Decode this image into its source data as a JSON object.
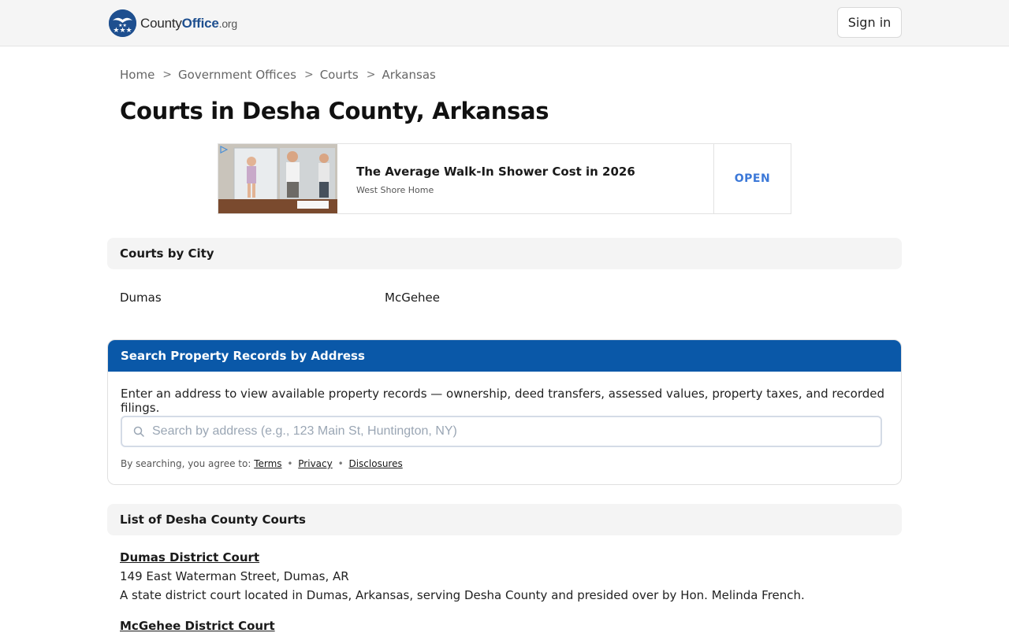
{
  "header": {
    "logo": {
      "part1": "County",
      "part2": "Office",
      "part3": ".org"
    },
    "signin_label": "Sign in"
  },
  "breadcrumb": [
    "Home",
    "Government Offices",
    "Courts",
    "Arkansas"
  ],
  "page_title": "Courts in Desha County, Arkansas",
  "ad": {
    "headline": "The Average Walk-In Shower Cost in 2026",
    "sponsor": "West Shore Home",
    "cta": "OPEN"
  },
  "courts_by_city": {
    "heading": "Courts by City",
    "cities": [
      "Dumas",
      "McGehee"
    ]
  },
  "search": {
    "heading": "Search Property Records by Address",
    "description": "Enter an address to view available property records — ownership, deed transfers, assessed values, property taxes, and recorded filings.",
    "placeholder": "Search by address (e.g., 123 Main St, Huntington, NY)",
    "agree_prefix": "By searching, you agree to:",
    "links": [
      "Terms",
      "Privacy",
      "Disclosures"
    ]
  },
  "court_list": {
    "heading": "List of Desha County Courts",
    "courts": [
      {
        "name": "Dumas District Court",
        "address": "149 East Waterman Street, Dumas, AR",
        "description": "A state district court located in Dumas, Arkansas, serving Desha County and presided over by Hon. Melinda French."
      },
      {
        "name": "McGehee District Court"
      }
    ]
  },
  "colors": {
    "brand_blue": "#0a58a8",
    "logo_blue": "#1e4f8f",
    "ad_cta": "#3b78d8"
  }
}
